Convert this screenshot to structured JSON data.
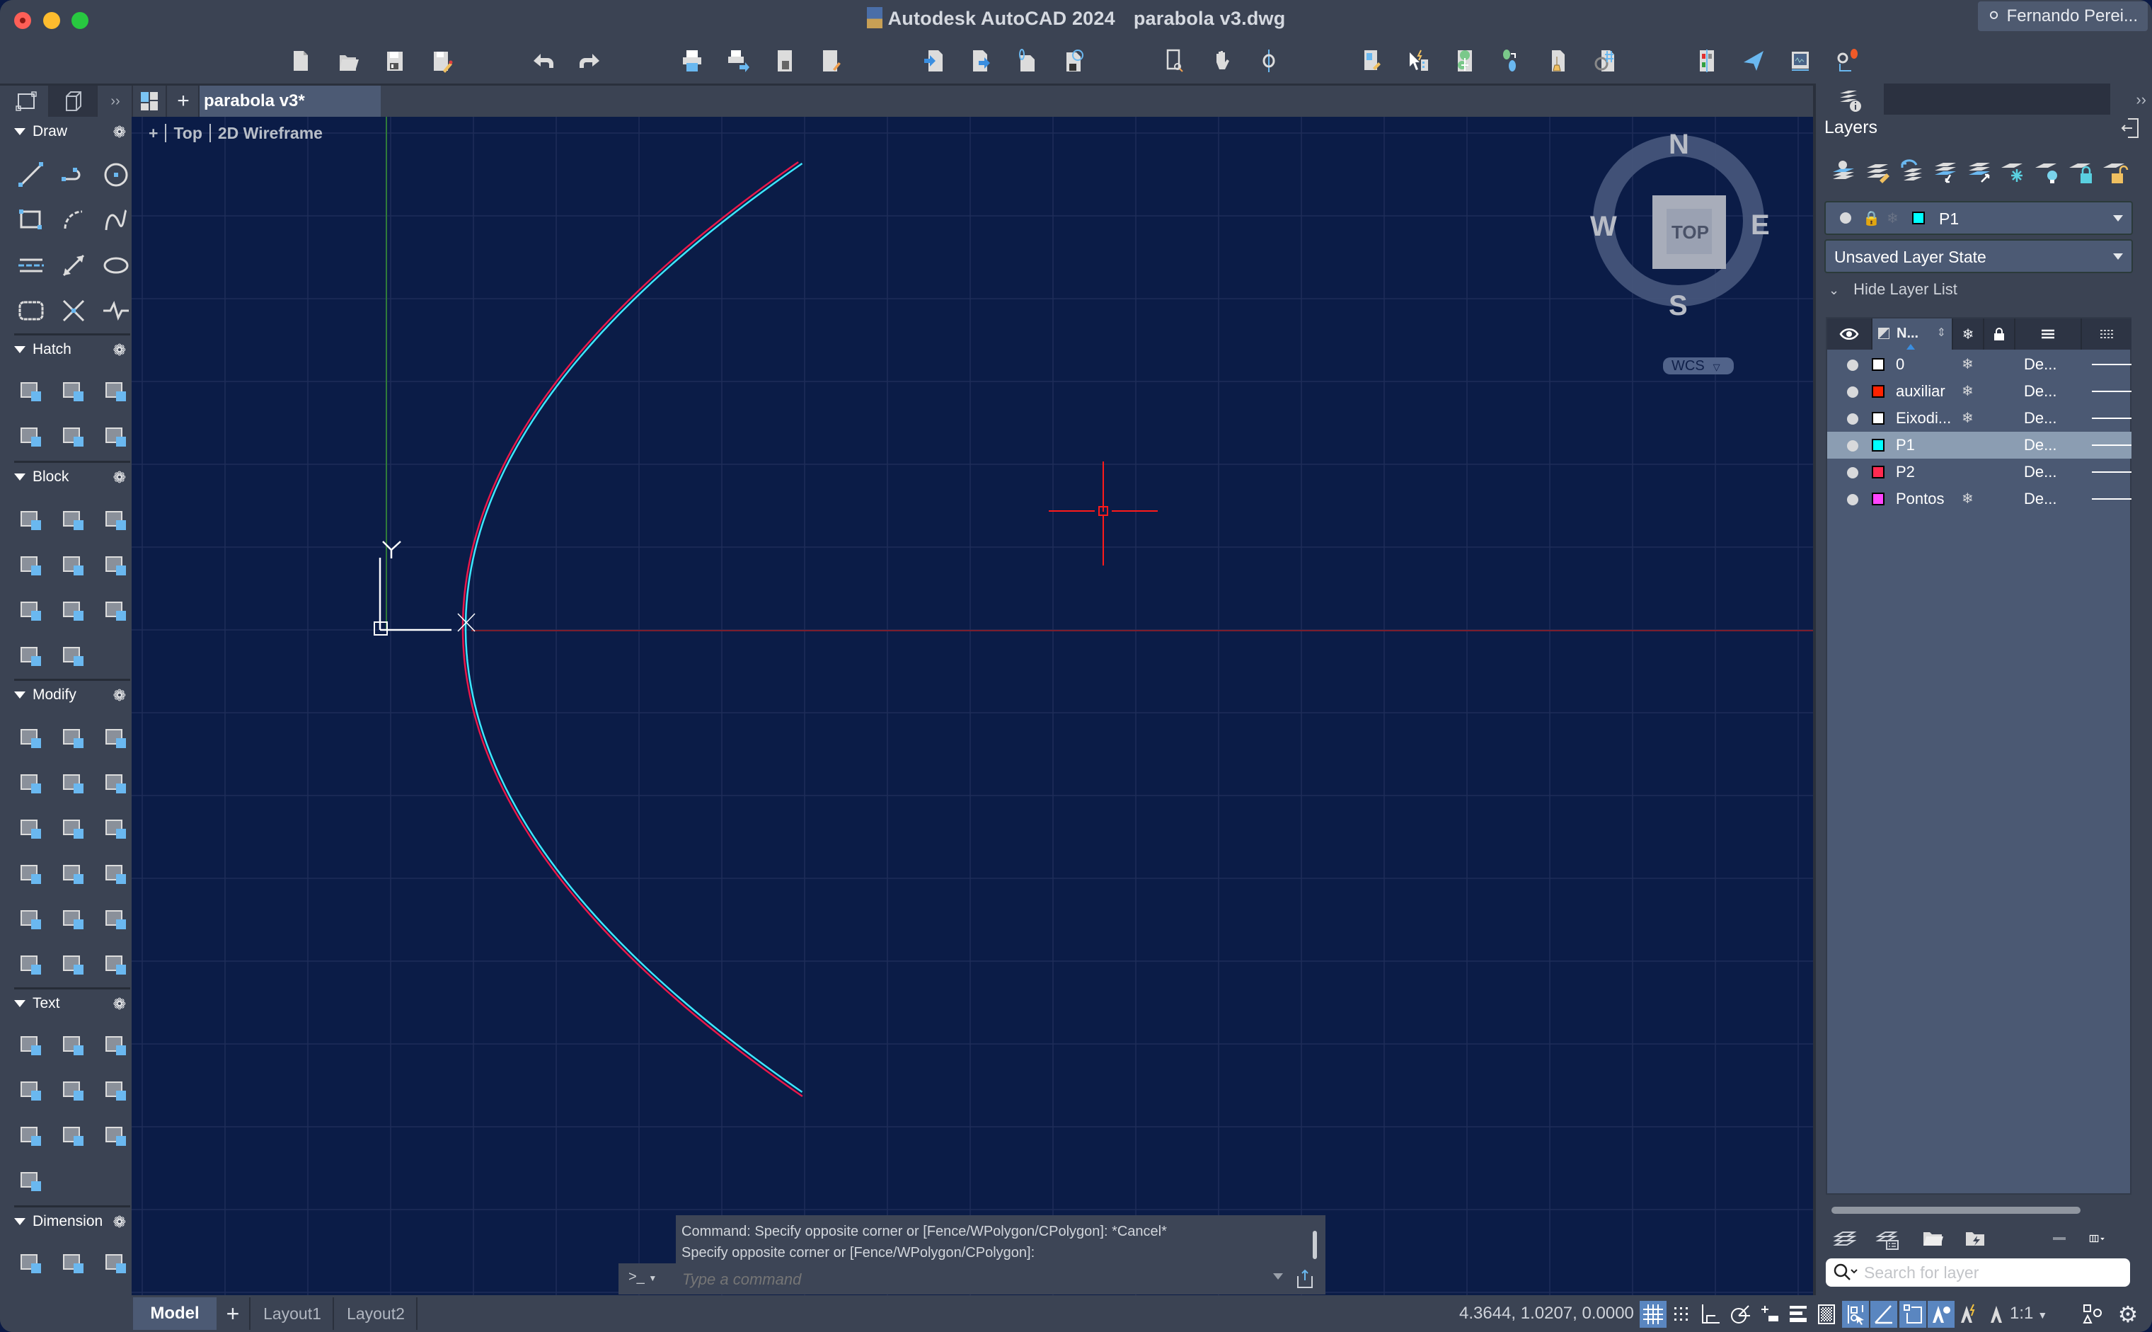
{
  "window": {
    "app_title": "Autodesk AutoCAD 2024",
    "file_title": "parabola v3.dwg",
    "user": "Fernando Perei..."
  },
  "toolbar": {
    "groups": [
      [
        "new-icon",
        "open-icon",
        "save-icon",
        "save-as-icon"
      ],
      [
        "undo-icon",
        "redo-icon"
      ],
      [
        "plot-icon",
        "batch-plot-icon",
        "page-setup-icon",
        "publish-icon"
      ],
      [
        "import-icon",
        "export-icon",
        "share-web-icon",
        "web-mobile-icon"
      ],
      [
        "zoom-window-icon",
        "pan-icon",
        "orbit-icon"
      ],
      [
        "properties-icon",
        "quick-select-icon",
        "design-center-icon",
        "tool-palettes-icon",
        "match-properties-icon",
        "measure-icon"
      ],
      [
        "compare-icon",
        "share-drawing-icon",
        "viewport-icon",
        "notifications-icon"
      ]
    ]
  },
  "tabs": {
    "file_tab": "parabola v3*"
  },
  "viewport": {
    "plus": "+",
    "view": "Top",
    "visual_style": "2D Wireframe",
    "ucs_y_label": "Y"
  },
  "viewcube": {
    "n": "N",
    "s": "S",
    "e": "E",
    "w": "W",
    "face": "TOP",
    "ucs": "WCS"
  },
  "left_palette": {
    "sections": [
      {
        "title": "Draw",
        "tools": [
          "line",
          "polyline",
          "circle",
          "rectangle",
          "arc",
          "spline",
          "construction-line",
          "dimension-line",
          "ellipse",
          "revision-cloud",
          "point",
          "break-line"
        ]
      },
      {
        "title": "Hatch",
        "tools": [
          "hatch",
          "hatch-edit",
          "gradient",
          "boundary",
          "region",
          "wipeout"
        ]
      },
      {
        "title": "Block",
        "tools": [
          "create-block",
          "insert-block",
          "edit-block",
          "define-attribute",
          "edit-attribute",
          "block-palette",
          "write-block",
          "insert-into",
          "sync-attributes",
          "manage-attributes",
          "block-replace"
        ]
      },
      {
        "title": "Modify",
        "tools": [
          "move",
          "copy",
          "mirror",
          "rotate",
          "stretch",
          "trim",
          "fillet",
          "offset",
          "array",
          "3d-box",
          "extend",
          "scale",
          "rect-scale",
          "break",
          "join",
          "replace",
          "block-swap",
          "purge"
        ]
      },
      {
        "title": "Text",
        "tools": [
          "multiline-text",
          "edit-text",
          "underline-text",
          "text-to-mtext",
          "spell-check",
          "find-text",
          "text-align",
          "text-update",
          "pdf-import-text",
          "pdf-repair"
        ]
      },
      {
        "title": "Dimension",
        "tools": [
          "smart-dim",
          "dim-style",
          "linear-dim"
        ]
      }
    ]
  },
  "command_line": {
    "history": [
      "Command: Specify opposite corner or [Fence/WPolygon/CPolygon]: *Cancel*",
      "Specify opposite corner or [Fence/WPolygon/CPolygon]:"
    ],
    "prompt": ">_",
    "placeholder": "Type a command"
  },
  "status_bar": {
    "model_tab": "Model",
    "layout_tabs": [
      "Layout1",
      "Layout2"
    ],
    "coordinates": "4.3644, 1.0207, 0.0000",
    "annotation_scale": "1:1",
    "toggles": [
      {
        "name": "grid",
        "on": true
      },
      {
        "name": "snap",
        "on": false
      },
      {
        "name": "ortho",
        "on": false
      },
      {
        "name": "polar",
        "on": false
      },
      {
        "name": "dynamic-input",
        "on": false
      },
      {
        "name": "lineweight",
        "on": false
      },
      {
        "name": "transparency",
        "on": false
      },
      {
        "name": "selection-cycling",
        "on": true
      },
      {
        "name": "object-snap-tracking",
        "on": true
      },
      {
        "name": "object-snap",
        "on": true
      },
      {
        "name": "annotation-visibility",
        "on": true
      },
      {
        "name": "auto-scale",
        "on": false
      },
      {
        "name": "annotation-monitor",
        "on": false
      }
    ]
  },
  "layers_panel": {
    "title": "Layers",
    "current_layer": {
      "name": "P1",
      "color": "#00ffff"
    },
    "layer_state": "Unsaved Layer State",
    "hide_list_label": "Hide Layer List",
    "column_header_name": "N...",
    "rows": [
      {
        "name": "0",
        "color": "#ffffff",
        "frozen_icon": true,
        "linetype": "De...",
        "selected": false
      },
      {
        "name": "auxiliar",
        "color": "#ff2200",
        "frozen_icon": true,
        "linetype": "De...",
        "selected": false
      },
      {
        "name": "Eixodi...",
        "color": "#ffffff",
        "frozen_icon": true,
        "linetype": "De...",
        "selected": false
      },
      {
        "name": "P1",
        "color": "#00ffff",
        "frozen_icon": false,
        "linetype": "De...",
        "selected": true
      },
      {
        "name": "P2",
        "color": "#ff2a50",
        "frozen_icon": false,
        "linetype": "De...",
        "selected": false
      },
      {
        "name": "Pontos",
        "color": "#ff44ff",
        "frozen_icon": true,
        "linetype": "De...",
        "selected": false
      }
    ],
    "search_placeholder": "Search for layer"
  },
  "drawing": {
    "curves": [
      {
        "layer": "P1",
        "color": "#3ce8ff"
      },
      {
        "layer": "P2",
        "color": "#e8184a"
      }
    ],
    "crosshair_color": "#ff1a1a",
    "x_axis_color": "#8a2030",
    "y_axis_color": "#2f7a3a"
  }
}
